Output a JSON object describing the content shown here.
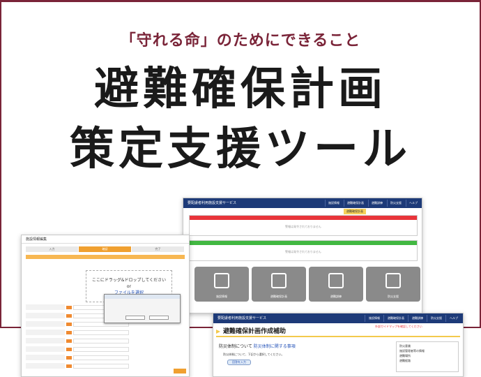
{
  "banner": {
    "subtitle": "「守れる命」のためにできること",
    "title_line1": "避難確保計画",
    "title_line2": "策定支援ツール",
    "accent_color": "#7a2438"
  },
  "screenshots": {
    "top_right": {
      "title": "要配慮者利用施設支援サービス",
      "menu": [
        "施設情報",
        "避難確保計画",
        "避難訓練",
        "防災支援",
        "ヘルプ"
      ],
      "tag": "避難確保計画",
      "red_panel_body": "警報は発令されておりません",
      "green_panel_body": "警報は発令されておりません",
      "tiles": [
        "施設情報",
        "避難確保計画",
        "避難訓練",
        "防災支援"
      ]
    },
    "left": {
      "header": "施設情報編集",
      "steps": [
        "入力",
        "確認",
        "完了"
      ],
      "dropzone_text": "ここにドラッグ&ドロップしてください",
      "dropzone_or": "or",
      "dropzone_link": "ファイルを選択"
    },
    "bottom_right": {
      "title": "要配慮者利用施設支援サービス",
      "menu": [
        "施設情報",
        "避難確保計画",
        "避難訓練",
        "防災支援",
        "ヘルプ"
      ],
      "heading": "避難確保計画作成補助",
      "note": "外部ガイドマップを確認してください",
      "question_prefix": "防災体制について",
      "question_link": "防災体制に関する事項",
      "answer": "防災体制について、下記から選択してください。",
      "button": "回答を入力",
      "side_lines": [
        "防災意識",
        "施設管理者等の情報",
        "避難場所",
        "避難経路"
      ]
    }
  }
}
